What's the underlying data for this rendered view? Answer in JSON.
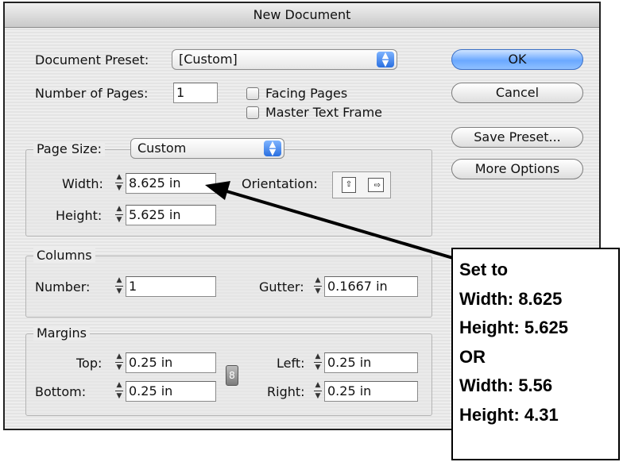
{
  "dialog": {
    "title": "New Document",
    "document_preset_label": "Document Preset:",
    "document_preset_value": "[Custom]",
    "number_of_pages_label": "Number of Pages:",
    "number_of_pages_value": "1",
    "facing_pages_label": "Facing Pages",
    "master_text_frame_label": "Master Text Frame",
    "facing_pages_checked": false,
    "master_text_frame_checked": false
  },
  "page_size": {
    "label": "Page Size:",
    "value": "Custom",
    "width_label": "Width:",
    "width_value": "8.625 in",
    "height_label": "Height:",
    "height_value": "5.625 in",
    "orientation_label": "Orientation:"
  },
  "columns": {
    "title": "Columns",
    "number_label": "Number:",
    "number_value": "1",
    "gutter_label": "Gutter:",
    "gutter_value": "0.1667 in"
  },
  "margins": {
    "title": "Margins",
    "top_label": "Top:",
    "top_value": "0.25 in",
    "bottom_label": "Bottom:",
    "bottom_value": "0.25 in",
    "left_label": "Left:",
    "left_value": "0.25 in",
    "right_label": "Right:",
    "right_value": "0.25 in"
  },
  "buttons": {
    "ok": "OK",
    "cancel": "Cancel",
    "save_preset": "Save Preset...",
    "more_options": "More Options"
  },
  "annotation": {
    "lines": [
      "Set to",
      "Width: 8.625",
      "Height: 5.625",
      "OR",
      "Width: 5.56",
      "Height: 4.31"
    ]
  },
  "colors": {
    "default_button": "#6aa8ff",
    "popup_arrows": "#2a6fe0"
  }
}
